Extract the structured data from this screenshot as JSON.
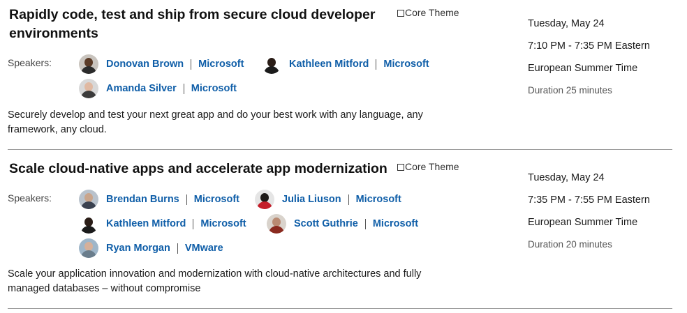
{
  "sessions": [
    {
      "title": "Rapidly code, test and ship from secure cloud developer environments",
      "theme": "Core Theme",
      "speakers_label": "Speakers:",
      "speakers": [
        {
          "name": "Donovan Brown",
          "org": "Microsoft",
          "avatar": "avatar-donovan-brown"
        },
        {
          "name": "Kathleen Mitford",
          "org": "Microsoft",
          "avatar": "avatar-kathleen-mitford"
        },
        {
          "name": "Amanda Silver",
          "org": "Microsoft",
          "avatar": "avatar-amanda-silver"
        }
      ],
      "description": "Securely develop and test your next great app and do your best work with any language, any framework, any cloud.",
      "date": "Tuesday, May 24",
      "time": "7:10 PM - 7:35 PM Eastern",
      "timezone": "European Summer Time",
      "duration": "Duration 25 minutes"
    },
    {
      "title": "Scale cloud-native apps and accelerate app modernization",
      "theme": "Core Theme",
      "speakers_label": "Speakers:",
      "speakers": [
        {
          "name": "Brendan Burns",
          "org": "Microsoft",
          "avatar": "avatar-brendan-burns"
        },
        {
          "name": "Julia Liuson",
          "org": "Microsoft",
          "avatar": "avatar-julia-liuson"
        },
        {
          "name": "Kathleen Mitford",
          "org": "Microsoft",
          "avatar": "avatar-kathleen-mitford"
        },
        {
          "name": "Scott Guthrie",
          "org": "Microsoft",
          "avatar": "avatar-scott-guthrie"
        },
        {
          "name": "Ryan Morgan",
          "org": "VMware",
          "avatar": "avatar-ryan-morgan"
        }
      ],
      "description": "Scale your application innovation and modernization with cloud-native architectures and fully managed databases – without compromise",
      "date": "Tuesday, May 24",
      "time": "7:35 PM - 7:55 PM Eastern",
      "timezone": "European Summer Time",
      "duration": "Duration 20 minutes"
    }
  ],
  "colors": {
    "link": "#0f5ea8",
    "divider": "#9a9a9a"
  }
}
